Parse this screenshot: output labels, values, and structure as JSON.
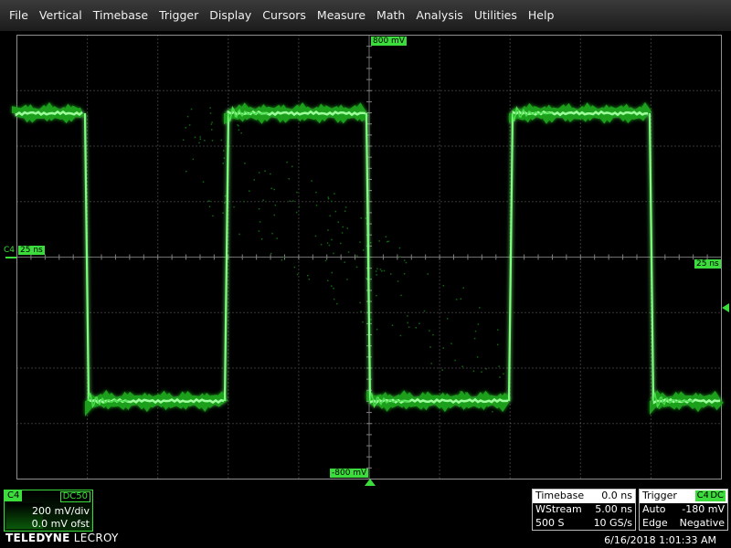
{
  "menu": {
    "items": [
      "File",
      "Vertical",
      "Timebase",
      "Trigger",
      "Display",
      "Cursors",
      "Measure",
      "Math",
      "Analysis",
      "Utilities",
      "Help"
    ]
  },
  "grid": {
    "top_label": "800 mV",
    "bottom_label": "-800 mV",
    "left_channel": "C4",
    "left_delay": "25 ns",
    "right_delay": "25 ns"
  },
  "channel": {
    "name": "C4",
    "coupling": "DC50",
    "vdiv": "200 mV/div",
    "offset": "0.0 mV ofst",
    "color": "#3cdc3c"
  },
  "brand": {
    "bold": "TELEDYNE",
    "light": " LECROY"
  },
  "timebase": {
    "label": "Timebase",
    "delay": "0.0 ns",
    "mode": "WStream",
    "tdiv": "5.00 ns",
    "samples": "500 S",
    "rate": "10 GS/s"
  },
  "trigger": {
    "label": "Trigger",
    "source": "C4",
    "coupling": "DC",
    "mode": "Auto",
    "level": "-180 mV",
    "type": "Edge",
    "slope": "Negative"
  },
  "datetime": "6/16/2018 1:01:33 AM"
}
